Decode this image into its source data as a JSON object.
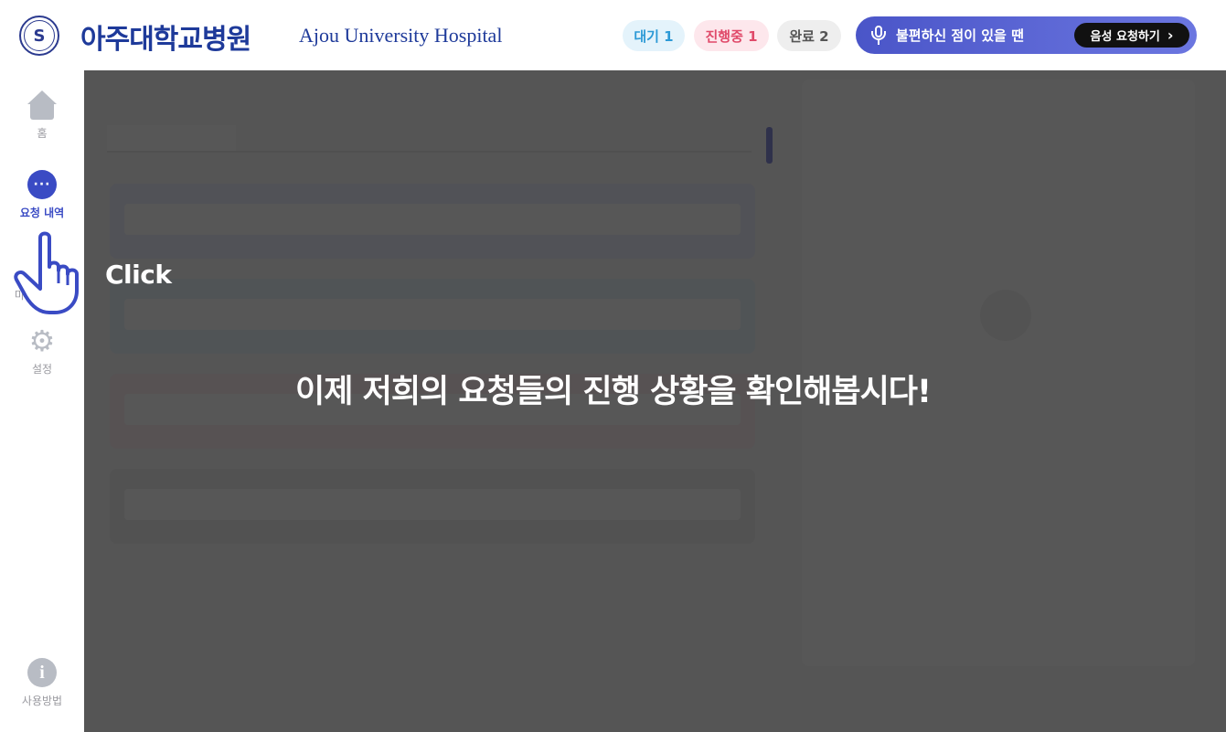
{
  "header": {
    "logo_ko": "아주대학교병원",
    "logo_en": "Ajou University Hospital",
    "logo_emblem_glyph": "S",
    "status": {
      "waiting": "대기 1",
      "in_progress": "진행중 1",
      "done": "완료 2"
    },
    "voice": {
      "text": "불편하신 점이 있을 땐",
      "button_label": "음성 요청하기",
      "button_chevron": "›"
    },
    "colors": {
      "brand": "#1e3a9a",
      "voice_bar": "#4a55c8"
    }
  },
  "sidebar": {
    "items": [
      {
        "label": "홈",
        "icon": "home-icon",
        "active": false
      },
      {
        "label": "요청 내역",
        "icon": "chat-icon",
        "active": true
      },
      {
        "label": "마",
        "icon": "my-page-icon",
        "active": false
      },
      {
        "label": "설정",
        "icon": "gear-icon",
        "active": false
      }
    ],
    "bottom": {
      "label": "사용방법",
      "icon": "info-icon"
    }
  },
  "tutorial": {
    "click_label": "Click",
    "message": "이제 저희의 요청들의 진행 상황을 확인해봅시다!"
  }
}
